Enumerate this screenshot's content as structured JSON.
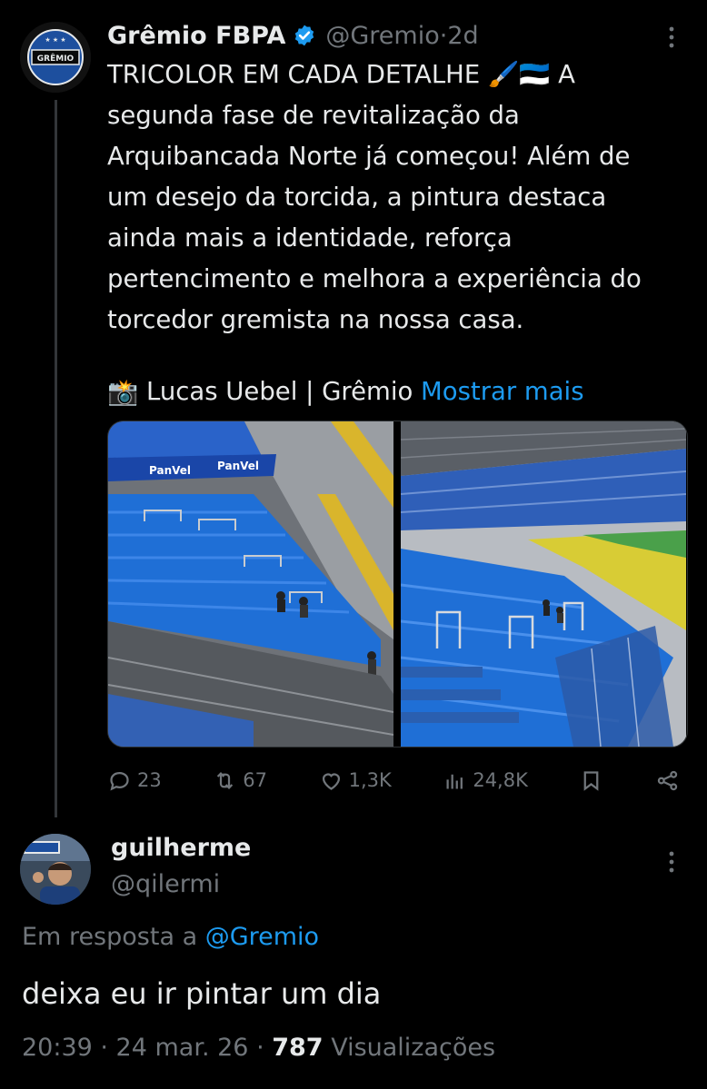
{
  "tweet": {
    "author_name": "Grêmio FBPA",
    "handle": "@Gremio",
    "separator": " · ",
    "time": "2d",
    "more_icon": "more-options-icon",
    "text": "TRICOLOR EM CADA DETALHE 🖌️🇪🇪 A\nsegunda fase de revitalização da\nArquibancada Norte já começou! Além de\num desejo da torcida, a pintura destaca\nainda mais a identidade, reforça\npertencimento e melhora a experiência do\ntorcedor gremista na nossa casa.",
    "credit_emoji": "📸",
    "credit": " Lucas Uebel | Grêmio ",
    "show_more": "Mostrar mais",
    "stats": {
      "replies": "23",
      "reposts": "67",
      "likes": "1,3K",
      "views": "24,8K"
    },
    "avatar_text": "GRÊMIO"
  },
  "reply": {
    "author_name": "guilherme",
    "handle": "@qilermi",
    "reply_prefix": "Em resposta a ",
    "reply_to": "@Gremio",
    "text": "deixa eu ir pintar um dia",
    "time": "20:39 · 24 mar. 26 · ",
    "views_count": "787",
    "views_label": " Visualizações"
  },
  "colors": {
    "background": "#000000",
    "text": "#e7e9ea",
    "secondary": "#71767b",
    "link": "#1d9bf0",
    "stadium_blue": "#1f6fd6"
  }
}
